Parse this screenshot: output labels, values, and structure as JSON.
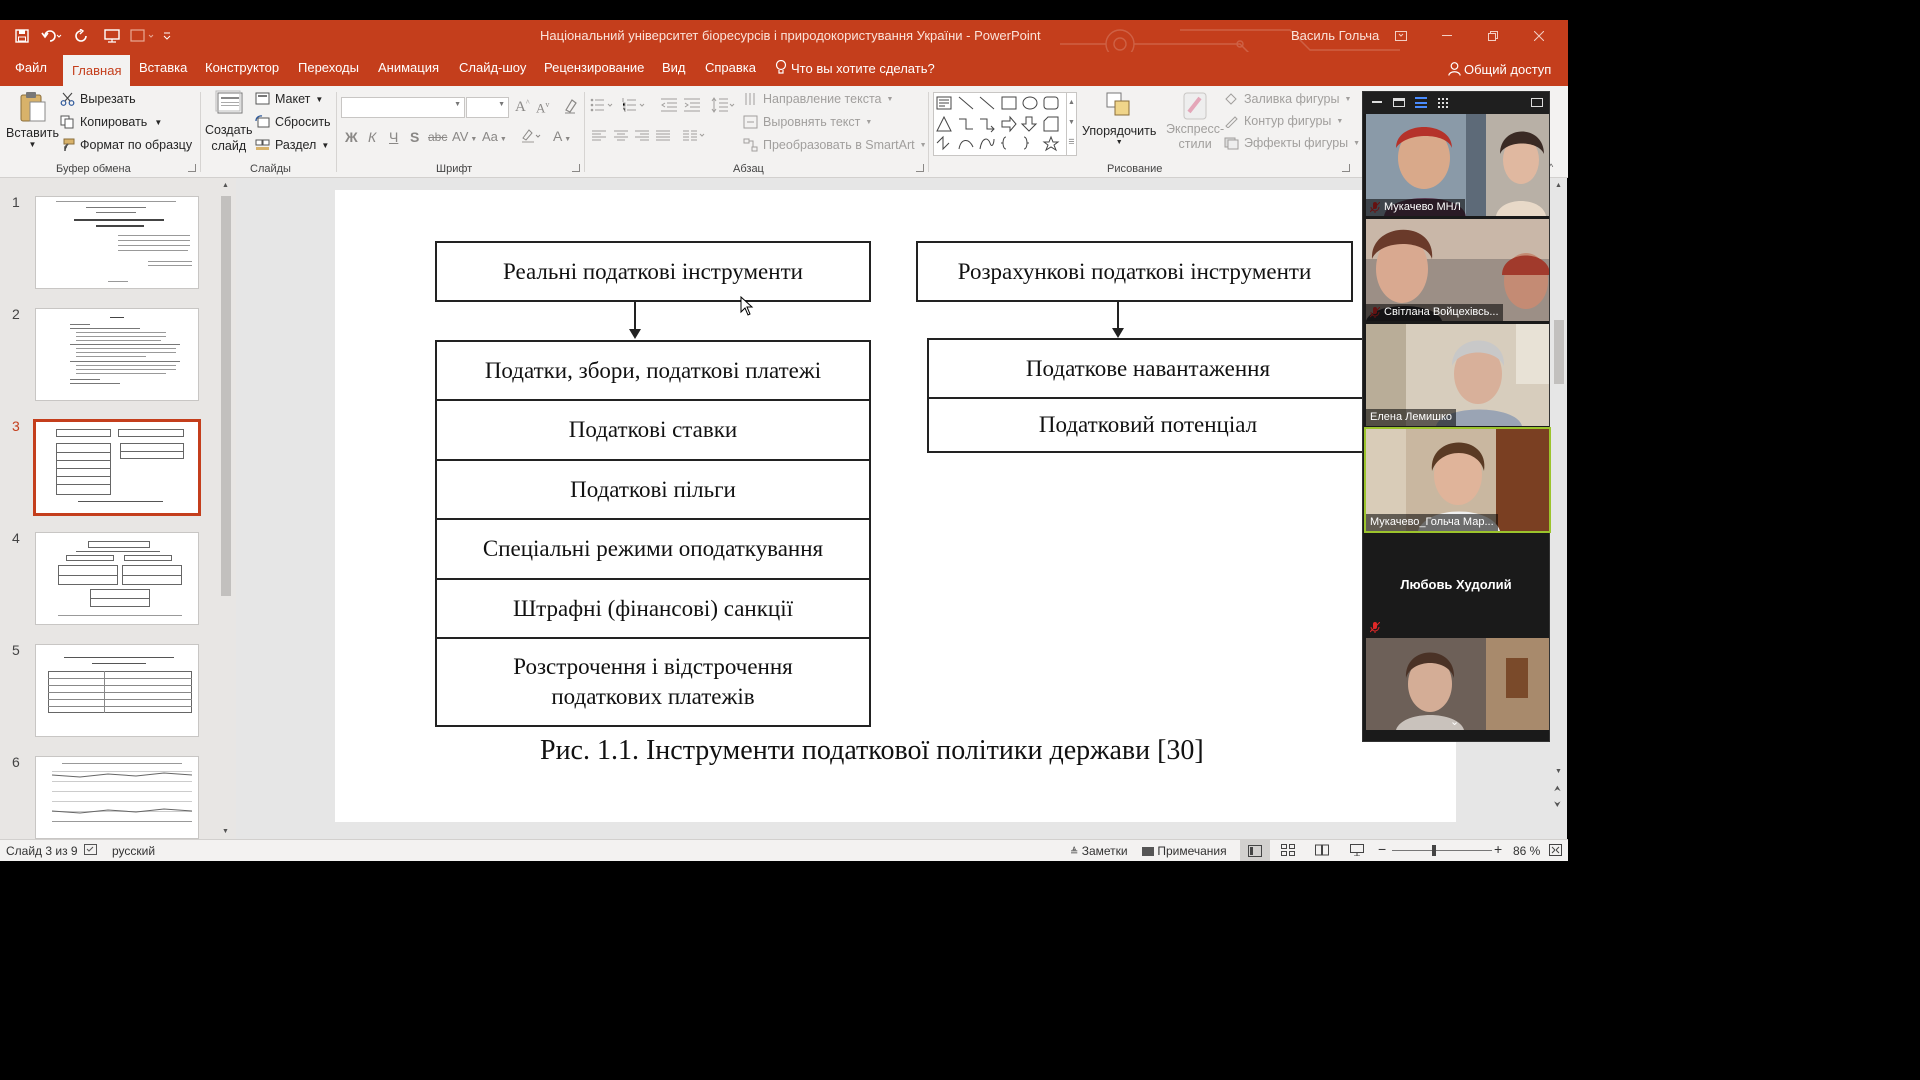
{
  "window": {
    "title": "Національний університет біоресурсів і природокористування України  -  PowerPoint",
    "user": "Василь Гольча"
  },
  "tabs": [
    {
      "label": "Файл"
    },
    {
      "label": "Главная"
    },
    {
      "label": "Вставка"
    },
    {
      "label": "Конструктор"
    },
    {
      "label": "Переходы"
    },
    {
      "label": "Анимация"
    },
    {
      "label": "Слайд-шоу"
    },
    {
      "label": "Рецензирование"
    },
    {
      "label": "Вид"
    },
    {
      "label": "Справка"
    }
  ],
  "tell_me": "Что вы хотите сделать?",
  "share": "Общий доступ",
  "ribbon": {
    "clipboard": {
      "paste": "Вставить",
      "cut": "Вырезать",
      "copy": "Копировать",
      "format_painter": "Формат по образцу",
      "group": "Буфер обмена"
    },
    "slides": {
      "new_slide": "Создать",
      "new_slide2": "слайд",
      "layout": "Макет",
      "reset": "Сбросить",
      "section": "Раздел",
      "group": "Слайды"
    },
    "font": {
      "group": "Шрифт",
      "bold": "Ж",
      "italic": "К",
      "underline": "Ч",
      "strike": "S",
      "shadow": "abc",
      "spacing": "AV",
      "case": "Aa"
    },
    "paragraph": {
      "group": "Абзац",
      "text_direction": "Направление текста",
      "align_text": "Выровнять текст",
      "smartart": "Преобразовать в SmartArt"
    },
    "drawing": {
      "group": "Рисование",
      "arrange": "Упорядочить",
      "quick_styles": "Экспресс-",
      "quick_styles2": "стили",
      "fill": "Заливка фигуры",
      "outline": "Контур фигуры",
      "effects": "Эффекты фигуры"
    }
  },
  "thumbnails": [
    {
      "number": "1"
    },
    {
      "number": "2"
    },
    {
      "number": "3"
    },
    {
      "number": "4"
    },
    {
      "number": "5"
    },
    {
      "number": "6"
    }
  ],
  "slide": {
    "left_header": "Реальні податкові інструменти",
    "right_header": "Розрахункові податкові інструменти",
    "left_items": [
      "Податки, збори, податкові платежі",
      "Податкові ставки",
      "Податкові пільги",
      "Спеціальні режими оподаткування",
      "Штрафні (фінансові) санкції",
      "Розстрочення і відстрочення податкових платежів"
    ],
    "right_items": [
      "Податкове навантаження",
      "Податковий потенціал"
    ],
    "caption": "Рис. 1.1. Інструменти податкової політики держави [30]"
  },
  "participants": [
    {
      "name": "Мукачево МНЛ"
    },
    {
      "name": "Світлана Войцехівсь..."
    },
    {
      "name": "Елена Лемишко"
    },
    {
      "name": "Мукачево_Гольча Мар..."
    },
    {
      "name": "Любовь Худолий"
    },
    {
      "name": ""
    }
  ],
  "status": {
    "slide_of": "Слайд 3 из 9",
    "language": "русский",
    "notes": "Заметки",
    "comments": "Примечания",
    "zoom": "86 %"
  },
  "colors": {
    "accent": "#c43e1c"
  }
}
